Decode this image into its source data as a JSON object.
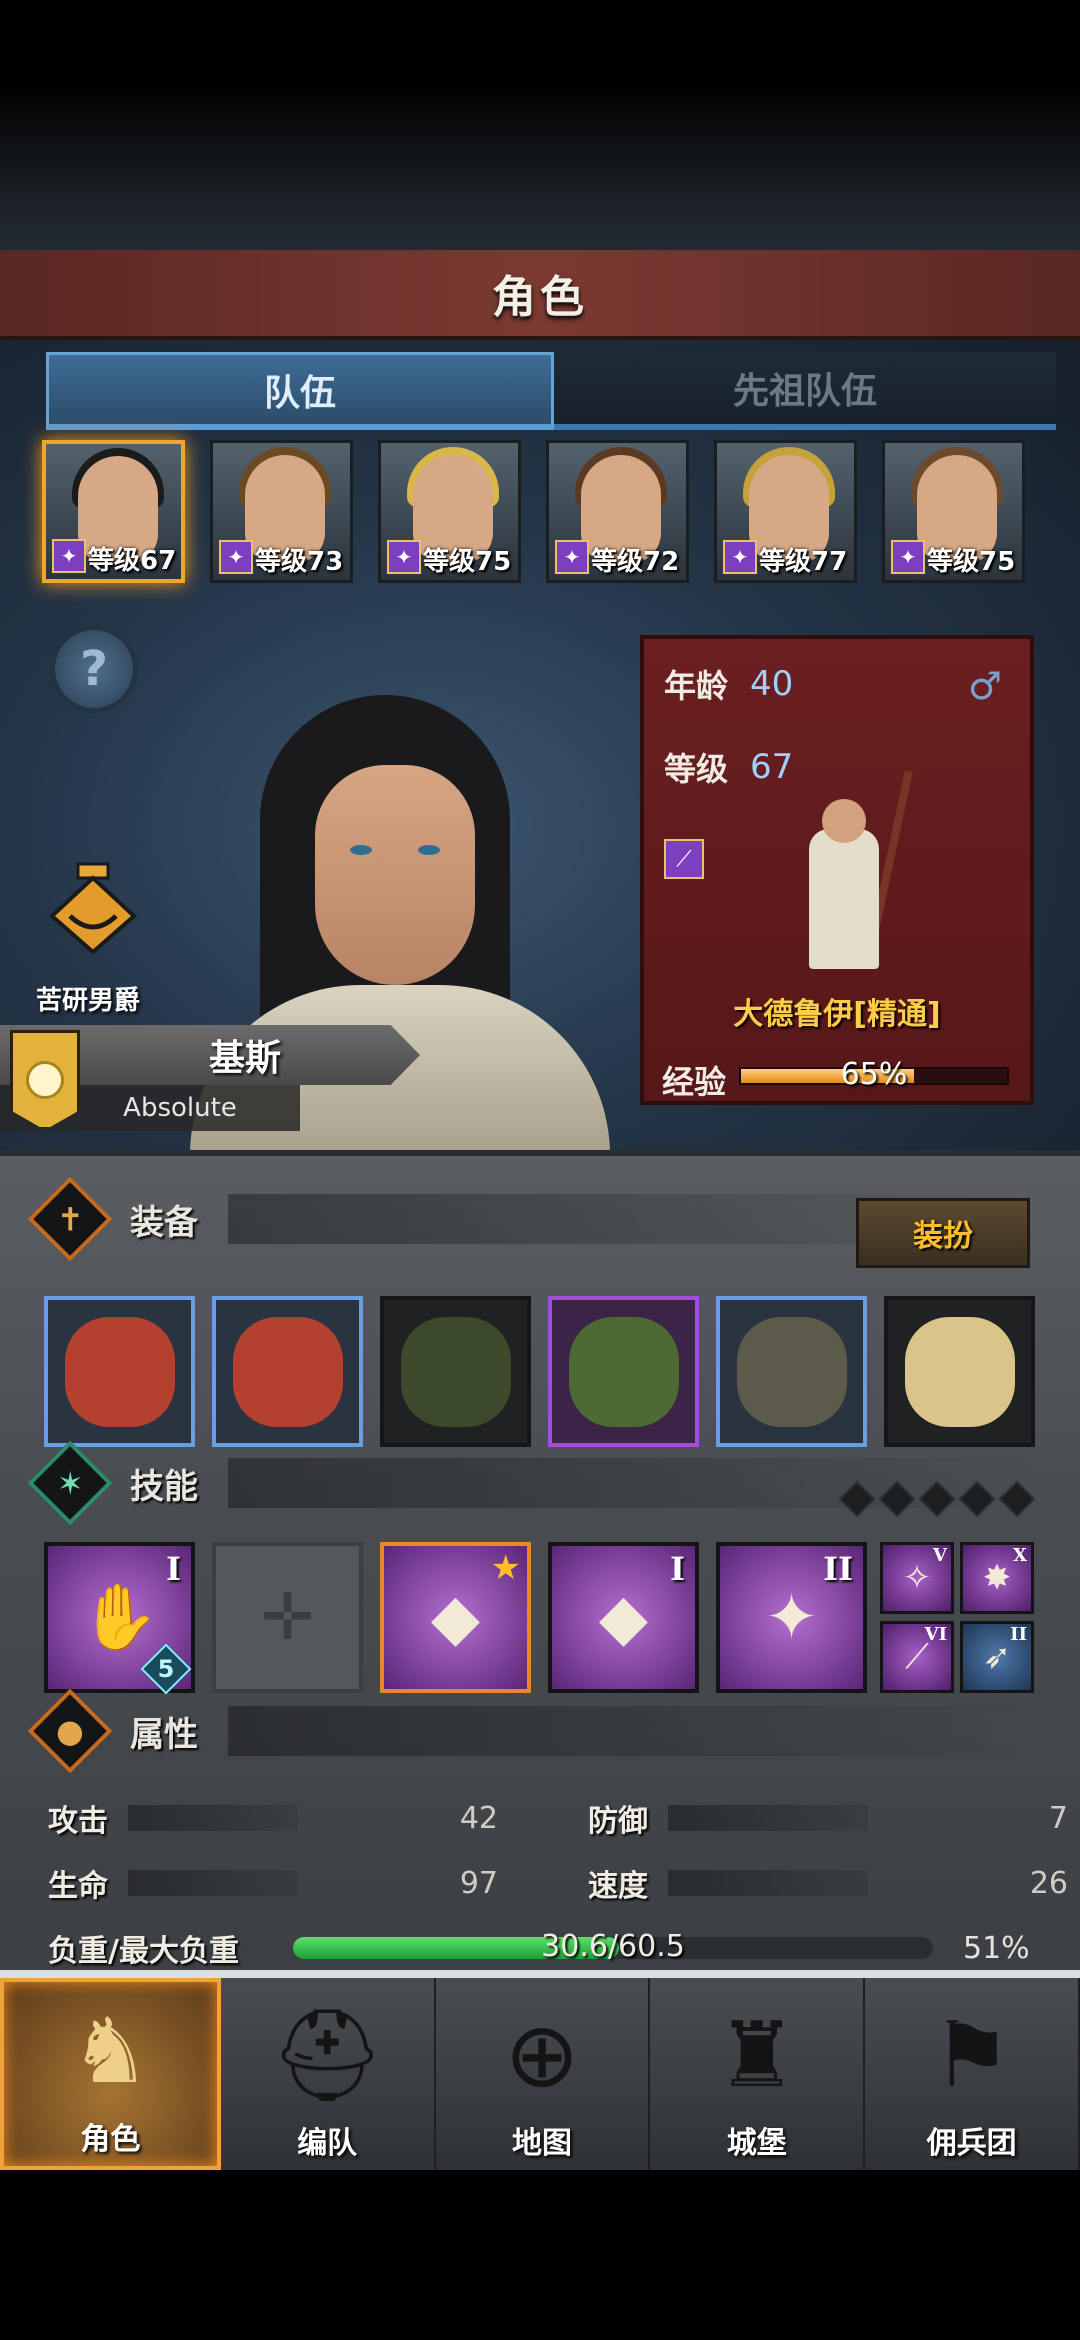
{
  "header": {
    "title": "角色"
  },
  "tabs": [
    {
      "label": "队伍",
      "active": true
    },
    {
      "label": "先祖队伍",
      "active": false
    }
  ],
  "party": [
    {
      "level_text": "等级67",
      "class_icon": "staff-icon",
      "hair": "#1b1b1b",
      "selected": true
    },
    {
      "level_text": "等级73",
      "class_icon": "shield-icon",
      "hair": "#6a4a22",
      "selected": false
    },
    {
      "level_text": "等级75",
      "class_icon": "sword-icon",
      "hair": "#d8b84a",
      "selected": false
    },
    {
      "level_text": "等级72",
      "class_icon": "horse-icon",
      "hair": "#5a3a22",
      "selected": false
    },
    {
      "level_text": "等级77",
      "class_icon": "bow-icon",
      "hair": "#c6a23a",
      "selected": false
    },
    {
      "level_text": "等级75",
      "class_icon": "bow-icon",
      "hair": "#6b4a2e",
      "selected": false
    }
  ],
  "character": {
    "title": "苦研男爵",
    "name": "基斯",
    "motto": "Absolute",
    "age_label": "年龄",
    "age": "40",
    "gender_icon": "male-icon",
    "level_label": "等级",
    "level": "67",
    "class_name": "大德鲁伊[精通]",
    "exp_label": "经验",
    "exp_text": "65%",
    "exp_fraction": 0.65
  },
  "equipment": {
    "title": "装备",
    "dress_button": "装扮",
    "slots": [
      {
        "name": "feather-weapon-icon",
        "rarity": "blue",
        "color": "#b4412f"
      },
      {
        "name": "feather-offhand-icon",
        "rarity": "blue",
        "color": "#b4412f"
      },
      {
        "name": "hood-icon",
        "rarity": "none",
        "color": "#3c4a2b"
      },
      {
        "name": "cloak-armor-icon",
        "rarity": "purple",
        "color": "#4d6a34"
      },
      {
        "name": "boots-icon",
        "rarity": "blue",
        "color": "#5c5a4a"
      },
      {
        "name": "amulet-icon",
        "rarity": "none",
        "color": "#d9c58a"
      }
    ]
  },
  "skills": {
    "title": "技能",
    "main": [
      {
        "icon": "flame-hand-icon",
        "glyph": "✋",
        "rank": "I",
        "level_badge": "5",
        "style": "normal"
      },
      {
        "icon": "empty-cross-icon",
        "glyph": "✛",
        "rank": "",
        "style": "empty"
      },
      {
        "icon": "crystal-tornado-icon",
        "glyph": "◆",
        "rank": "★",
        "style": "gold"
      },
      {
        "icon": "crystal-arm-icon",
        "glyph": "◆",
        "rank": "I",
        "style": "normal"
      },
      {
        "icon": "star-staff-icon",
        "glyph": "✦",
        "rank": "II",
        "style": "normal"
      }
    ],
    "mini": [
      {
        "icon": "target-star-icon",
        "glyph": "✧",
        "rank": "V",
        "style": "purple"
      },
      {
        "icon": "burst-icon",
        "glyph": "✸",
        "rank": "X",
        "style": "purple"
      },
      {
        "icon": "staff-icon",
        "glyph": "⟋",
        "rank": "VI",
        "style": "purple"
      },
      {
        "icon": "bird-icon",
        "glyph": "➶",
        "rank": "II",
        "style": "blue"
      }
    ]
  },
  "attributes": {
    "title": "属性",
    "stats": [
      {
        "label": "攻击",
        "value": "42"
      },
      {
        "label": "防御",
        "value": "7"
      },
      {
        "label": "生命",
        "value": "97"
      },
      {
        "label": "速度",
        "value": "26"
      }
    ],
    "load_label": "负重/最大负重",
    "load_text": "30.6/60.5",
    "load_fraction": 0.51,
    "load_pct": "51%"
  },
  "nav": [
    {
      "label": "角色",
      "icon": "knight-icon",
      "glyph": "♞",
      "active": true
    },
    {
      "label": "编队",
      "icon": "helmet-icon",
      "glyph": "⛑",
      "active": false
    },
    {
      "label": "地图",
      "icon": "compass-map-icon",
      "glyph": "⊕",
      "active": false
    },
    {
      "label": "城堡",
      "icon": "castle-icon",
      "glyph": "♜",
      "active": false
    },
    {
      "label": "佣兵团",
      "icon": "banner-icon",
      "glyph": "⚑",
      "active": false
    }
  ],
  "colors": {
    "accent": "#f0a62a",
    "card": "#6b1f20",
    "tab_active": "#3f6d96"
  }
}
